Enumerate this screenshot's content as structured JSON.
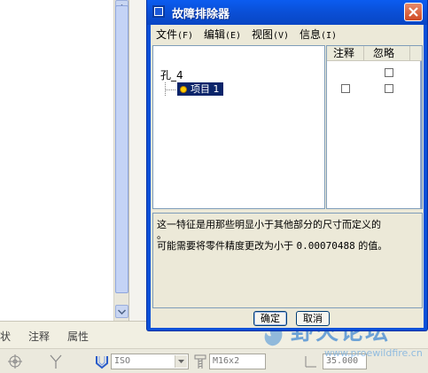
{
  "dialog": {
    "title": "故障排除器",
    "close_symbol": "×"
  },
  "menu": {
    "file": {
      "label": "文件",
      "accel": "(F)"
    },
    "edit": {
      "label": "编辑",
      "accel": "(E)"
    },
    "view": {
      "label": "视图",
      "accel": "(V)"
    },
    "info": {
      "label": "信息",
      "accel": "(I)"
    }
  },
  "tree": {
    "root": "孔_4",
    "item": "项目 1"
  },
  "table": {
    "headers": {
      "notes": "注释",
      "ignore": "忽略"
    }
  },
  "message": {
    "line1": "这一特征是用那些明显小于其他部分的尺寸而定义的",
    "line2": "。",
    "line3_pre": "可能需要将零件精度更改为小于 ",
    "line3_value": "0.00070488",
    "line3_post": " 的值。"
  },
  "buttons": {
    "ok": "确定",
    "cancel": "取消"
  },
  "background": {
    "tabs": [
      "状",
      "注释",
      "属性"
    ],
    "standard_combo": "ISO",
    "size_combo": "M16x2",
    "value_combo": "35.000"
  },
  "watermark": {
    "text": "野火论坛",
    "url": "www.proewildfire.cn"
  },
  "colors": {
    "titlebar": "#0a50d8",
    "selection": "#0a246a",
    "dialog_bg": "#ece9d8"
  }
}
